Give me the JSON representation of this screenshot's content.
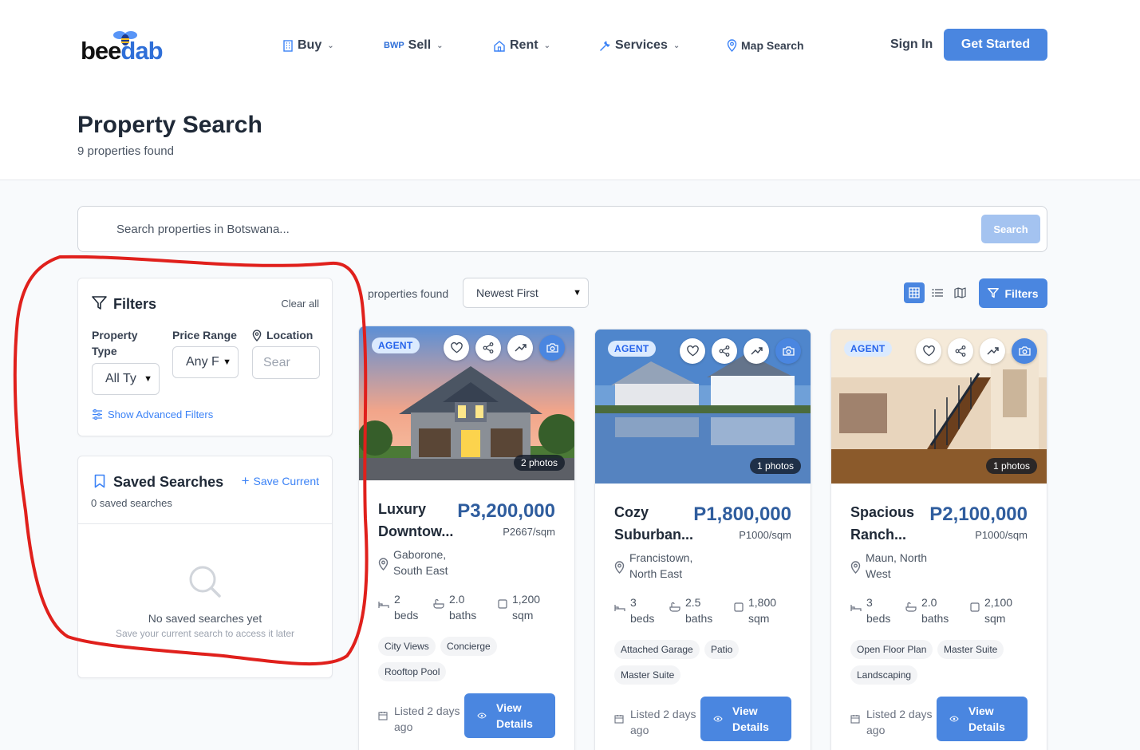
{
  "brand": {
    "logo_part1": "bee",
    "logo_part2": "dab"
  },
  "nav": {
    "buy": "Buy",
    "sell_badge": "BWP",
    "sell": "Sell",
    "rent": "Rent",
    "services": "Services",
    "map_search": "Map Search",
    "sign_in": "Sign In",
    "get_started": "Get Started"
  },
  "header": {
    "title": "Property Search",
    "count": "9 properties found"
  },
  "search": {
    "placeholder": "Search properties in Botswana...",
    "button": "Search"
  },
  "filters": {
    "title": "Filters",
    "clear": "Clear all",
    "property_type_label": "Property Type",
    "property_type_value": "All Ty",
    "price_range_label": "Price Range",
    "price_range_value": "Any F",
    "location_label": "Location",
    "location_placeholder": "Sear",
    "advanced": "Show Advanced Filters"
  },
  "saved": {
    "title": "Saved Searches",
    "save_current": "Save Current",
    "count": "0 saved searches",
    "empty_title": "No saved searches yet",
    "empty_sub": "Save your current search to access it later"
  },
  "results": {
    "count": "properties found",
    "sort": "Newest First",
    "filters_button": "Filters"
  },
  "listings": [
    {
      "badge": "AGENT",
      "photos": "2 photos",
      "title": "Luxury Downtow...",
      "price": "P3,200,000",
      "per_sqm": "P2667/sqm",
      "location": "Gaborone, South East",
      "beds": "2 beds",
      "baths": "2.0 baths",
      "sqm": "1,200 sqm",
      "tags": [
        "City Views",
        "Concierge",
        "Rooftop Pool"
      ],
      "listed": "Listed 2 days ago",
      "view": "View Details"
    },
    {
      "badge": "AGENT",
      "photos": "1 photos",
      "title": "Cozy Suburban...",
      "price": "P1,800,000",
      "per_sqm": "P1000/sqm",
      "location": "Francistown, North East",
      "beds": "3 beds",
      "baths": "2.5 baths",
      "sqm": "1,800 sqm",
      "tags": [
        "Attached Garage",
        "Patio",
        "Master Suite"
      ],
      "listed": "Listed 2 days ago",
      "view": "View Details"
    },
    {
      "badge": "AGENT",
      "photos": "1 photos",
      "title": "Spacious Ranch...",
      "price": "P2,100,000",
      "per_sqm": "P1000/sqm",
      "location": "Maun, North West",
      "beds": "3 beds",
      "baths": "2.0 baths",
      "sqm": "2,100 sqm",
      "tags": [
        "Open Floor Plan",
        "Master Suite",
        "Landscaping"
      ],
      "listed": "Listed 2 days ago",
      "view": "View Details"
    }
  ],
  "colors": {
    "accent": "#4a86e0",
    "price": "#2f5d9e",
    "annotation": "#e0201c"
  }
}
